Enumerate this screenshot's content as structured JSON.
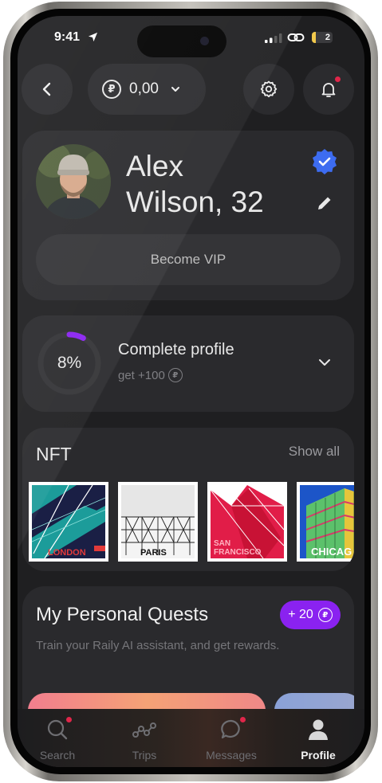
{
  "status_bar": {
    "time": "9:41",
    "battery_level": "2",
    "battery_fraction": 0.2
  },
  "header": {
    "balance_value": "0,00",
    "currency_symbol": "₽",
    "back_icon": "chevron-left-icon",
    "settings_icon": "gear-icon",
    "notifications_icon": "bell-icon",
    "has_notification": true
  },
  "profile": {
    "name_line1": "Alex",
    "name_line2": "Wilson, 32",
    "verified": true,
    "vip_button_label": "Become VIP"
  },
  "completion": {
    "percent_label": "8%",
    "percent_value": 0.08,
    "title": "Complete profile",
    "subtitle": "get +100",
    "currency_symbol": "₽"
  },
  "nft": {
    "title": "NFT",
    "show_all_label": "Show all",
    "items": [
      {
        "label": "LONDON"
      },
      {
        "label": "PARIS"
      },
      {
        "label": "SAN FRANCISCO",
        "label_line1": "SAN",
        "label_line2": "FRANCISCO"
      },
      {
        "label": "CHICAG"
      }
    ]
  },
  "quests": {
    "title": "My Personal Quests",
    "reward_label": "+ 20",
    "currency_symbol": "₽",
    "description": "Train your Raily AI assistant, and get rewards."
  },
  "tabbar": {
    "tabs": [
      {
        "label": "Search",
        "icon": "search-icon",
        "active": false,
        "badge": true
      },
      {
        "label": "Trips",
        "icon": "route-icon",
        "active": false,
        "badge": false
      },
      {
        "label": "Messages",
        "icon": "chat-icon",
        "active": false,
        "badge": true
      },
      {
        "label": "Profile",
        "icon": "user-icon",
        "active": true,
        "badge": false
      }
    ]
  },
  "colors": {
    "accent": "#8a22f0",
    "notification_dot": "#e0264a",
    "verified_badge": "#3d6cf0",
    "battery": "#f2c94c"
  }
}
